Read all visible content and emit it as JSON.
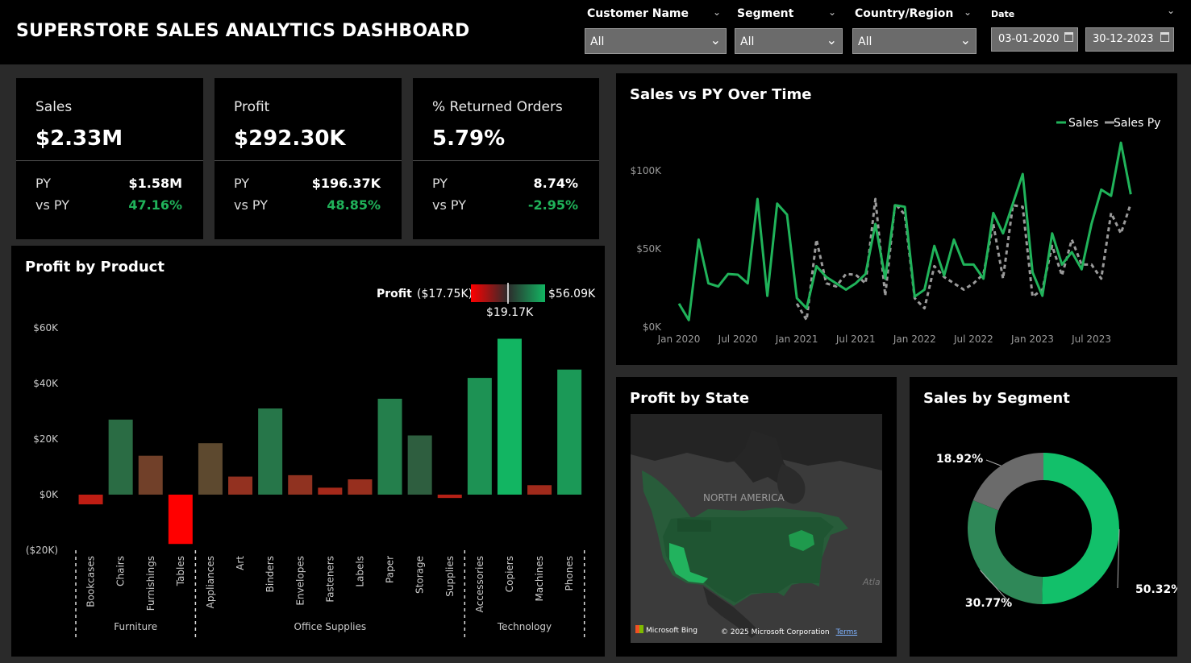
{
  "header": {
    "title": "SUPERSTORE SALES ANALYTICS DASHBOARD"
  },
  "filters": [
    {
      "label": "Customer Name",
      "value": "All"
    },
    {
      "label": "Segment",
      "value": "All"
    },
    {
      "label": "Country/Region",
      "value": "All"
    }
  ],
  "date_filter": {
    "label": "Date",
    "start": "03-01-2020",
    "end": "30-12-2023"
  },
  "kpis": [
    {
      "name": "Sales",
      "value": "$2.33M",
      "py_label": "PY",
      "py": "$1.58M",
      "vs_label": "vs PY",
      "vs": "47.16%"
    },
    {
      "name": "Profit",
      "value": "$292.30K",
      "py_label": "PY",
      "py": "$196.37K",
      "vs_label": "vs PY",
      "vs": "48.85%"
    },
    {
      "name": "% Returned Orders",
      "value": "5.79%",
      "py_label": "PY",
      "py": "8.74%",
      "vs_label": "vs PY",
      "vs": "-2.95%"
    }
  ],
  "profit_by_product": {
    "title": "Profit by Product",
    "legend": {
      "label": "Profit",
      "min": "($17.75K)",
      "mid": "$19.17K",
      "max": "$56.09K"
    }
  },
  "sales_vs_py": {
    "title": "Sales vs PY Over Time",
    "legend": [
      "Sales",
      "Sales Py"
    ]
  },
  "profit_by_state": {
    "title": "Profit by State",
    "map_label_1": "NORTH AMERICA",
    "map_label_2": "Atla",
    "bing": "Microsoft Bing",
    "copyright": "© 2025 Microsoft Corporation",
    "terms": "Terms"
  },
  "sales_by_segment": {
    "title": "Sales by Segment"
  },
  "chart_data": [
    {
      "type": "bar",
      "title": "Profit by Product",
      "groups": [
        {
          "name": "Furniture",
          "categories": [
            "Bookcases",
            "Chairs",
            "Furnishings",
            "Tables"
          ]
        },
        {
          "name": "Office Supplies",
          "categories": [
            "Appliances",
            "Art",
            "Binders",
            "Envelopes",
            "Fasteners",
            "Labels",
            "Paper",
            "Storage",
            "Supplies"
          ]
        },
        {
          "name": "Technology",
          "categories": [
            "Accessories",
            "Copiers",
            "Machines",
            "Phones"
          ]
        }
      ],
      "categories": [
        "Bookcases",
        "Chairs",
        "Furnishings",
        "Tables",
        "Appliances",
        "Art",
        "Binders",
        "Envelopes",
        "Fasteners",
        "Labels",
        "Paper",
        "Storage",
        "Supplies",
        "Accessories",
        "Copiers",
        "Machines",
        "Phones"
      ],
      "values": [
        -3.5,
        27,
        14,
        -17.75,
        18.5,
        6.5,
        31,
        7,
        2.5,
        5.5,
        34.5,
        21.3,
        -1.2,
        42,
        56.09,
        3.4,
        45
      ],
      "unit": "K",
      "ylim": [
        -20,
        60
      ],
      "yticks": [
        "($20K)",
        "$0K",
        "$20K",
        "$40K",
        "$60K"
      ],
      "color_scale": {
        "min": "#ff0000",
        "mid": "#2c2c2c",
        "max": "#12b562"
      }
    },
    {
      "type": "line",
      "title": "Sales vs PY Over Time",
      "x_ticks": [
        "Jan 2020",
        "Jul 2020",
        "Jan 2021",
        "Jul 2021",
        "Jan 2022",
        "Jul 2022",
        "Jan 2023",
        "Jul 2023"
      ],
      "x_start": "Jan 2020",
      "ylim": [
        0,
        115
      ],
      "yticks": [
        "$0K",
        "$50K",
        "$100K"
      ],
      "series": [
        {
          "name": "Sales",
          "color": "#20b35a",
          "dash": false,
          "start_index": 0,
          "values": [
            15,
            4.5,
            56,
            28,
            26,
            34,
            33.5,
            28,
            82,
            20,
            79,
            72,
            18.5,
            12,
            39,
            32,
            28,
            24,
            28,
            34,
            66,
            31,
            78,
            77,
            19.5,
            24,
            52,
            33,
            56,
            40,
            40,
            31,
            73,
            60,
            79,
            98,
            35,
            20,
            60,
            40,
            48,
            37,
            66,
            88,
            84,
            118,
            85
          ]
        },
        {
          "name": "Sales Py",
          "color": "#9a9a9a",
          "dash": true,
          "start_index": 12,
          "values": [
            15,
            4.5,
            56,
            28,
            26,
            34,
            33.5,
            28,
            82,
            20,
            79,
            72,
            18.5,
            12,
            39,
            32,
            28,
            24,
            28,
            34,
            66,
            31,
            78,
            77,
            19.5,
            24,
            52,
            33,
            56,
            40,
            40,
            31,
            73,
            60,
            79
          ]
        }
      ]
    },
    {
      "type": "pie",
      "title": "Sales by Segment",
      "labels": [
        "50.32%",
        "30.77%",
        "18.92%"
      ],
      "values": [
        50.32,
        30.77,
        18.92
      ],
      "colors": [
        "#12c06a",
        "#2f8858",
        "#6b6b6b"
      ]
    }
  ]
}
